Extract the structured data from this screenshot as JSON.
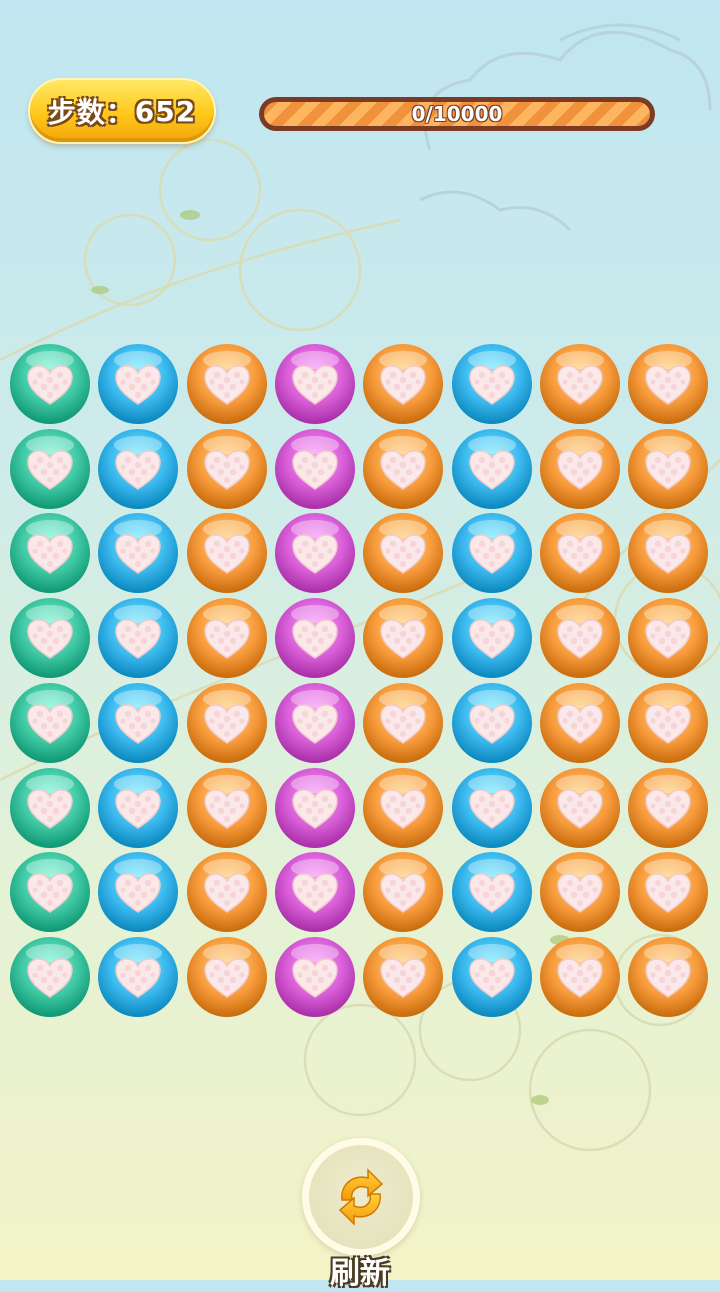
{
  "hud": {
    "moves_label": "步数：",
    "moves_value": "652",
    "score_text": "0/10000",
    "score_progress": 0.0
  },
  "board": {
    "columns": 8,
    "rows": 8,
    "tile_icon": "heart-icon",
    "column_colors": [
      "teal",
      "blue",
      "orange",
      "magenta",
      "orange",
      "blue",
      "orange",
      "orange"
    ]
  },
  "colors": {
    "teal": "#3ec7a2",
    "blue": "#3ab8ee",
    "orange": "#f79b3c",
    "magenta": "#d85ed8",
    "heart": "#fbe9ea",
    "gold": "#ffc81a",
    "progress_border": "#7a3a26"
  },
  "refresh": {
    "label": "刷新",
    "icon": "refresh-icon"
  }
}
